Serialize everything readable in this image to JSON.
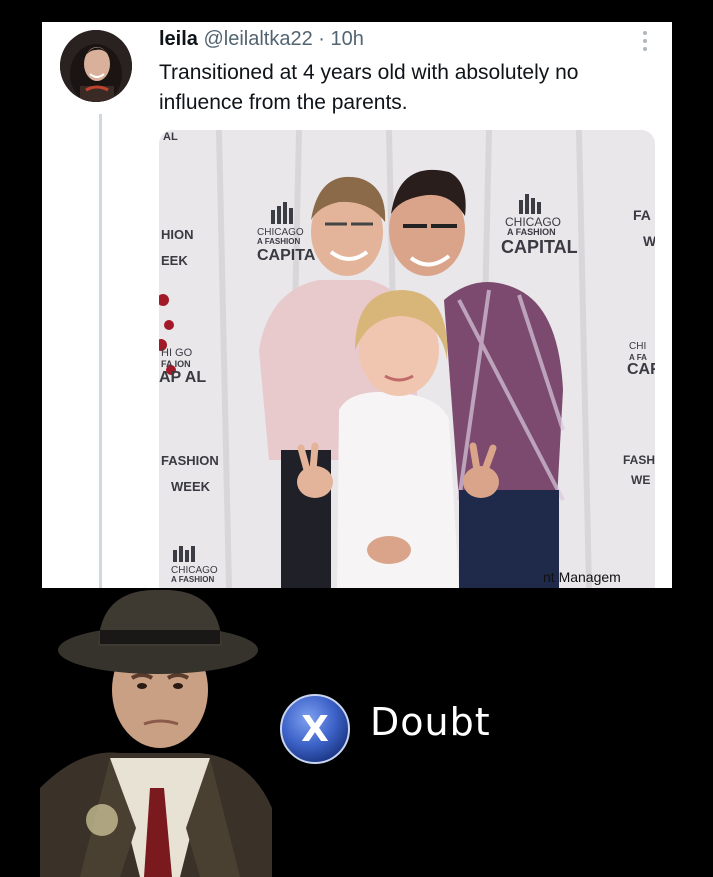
{
  "tweet": {
    "display_name": "leila",
    "handle": "@leilaltka22",
    "separator": "·",
    "time": "10h",
    "text": "Transitioned at 4 years old with absolutely no influence from the parents.",
    "photo": {
      "backdrop_labels": [
        "AL",
        "HION",
        "EEK",
        "CHICAGO",
        "A FASHION",
        "CAPITA",
        "CHICAGO",
        "A FASHION",
        "CAPITAL",
        "FA",
        "W",
        "HI GO",
        "FA ION",
        "AP AL",
        "CHI",
        "A FA",
        "CAF",
        "FASHION",
        "WEEK",
        "FASH",
        "WE",
        "CHICAGO",
        "A FASHION",
        "nt Managem"
      ]
    }
  },
  "meme": {
    "button_glyph": "X",
    "caption": "Doubt"
  },
  "colors": {
    "background": "#000000",
    "card": "#ffffff",
    "text": "#0f1419",
    "muted": "#536471",
    "ps_button_blue": "#3d63c9"
  },
  "icons": [
    "more-options-icon",
    "x-button-icon"
  ]
}
